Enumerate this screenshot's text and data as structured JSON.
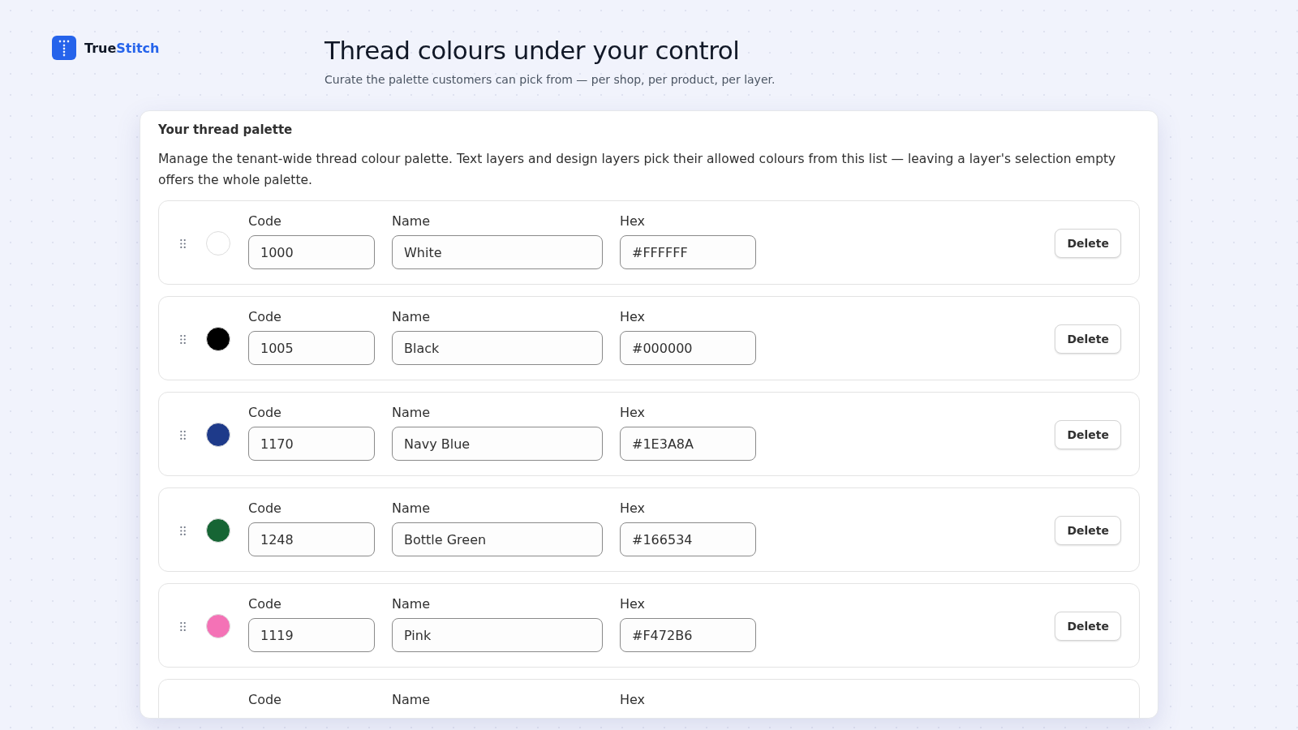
{
  "brand": {
    "name_plain": "True",
    "name_accent": "Stitch"
  },
  "header": {
    "title": "Thread colours under your control",
    "subtitle": "Curate the palette customers can pick from — per shop, per product, per layer."
  },
  "palette": {
    "title": "Your thread palette",
    "description": "Manage the tenant-wide thread colour palette. Text layers and design layers pick their allowed colours from this list — leaving a layer's selection empty offers the whole palette.",
    "rows": [
      {
        "color": "#ffffff",
        "code_label": "Code",
        "code": "1000",
        "name_label": "Name",
        "name": "White",
        "hex_label": "Hex",
        "hex": "#FFFFFF",
        "action": "Delete"
      },
      {
        "color": "#000000",
        "code_label": "Code",
        "code": "1005",
        "name_label": "Name",
        "name": "Black",
        "hex_label": "Hex",
        "hex": "#000000",
        "action": "Delete"
      },
      {
        "color": "#1e3a8a",
        "code_label": "Code",
        "code": "1170",
        "name_label": "Name",
        "name": "Navy Blue",
        "hex_label": "Hex",
        "hex": "#1E3A8A",
        "action": "Delete"
      },
      {
        "color": "#166534",
        "code_label": "Code",
        "code": "1248",
        "name_label": "Name",
        "name": "Bottle Green",
        "hex_label": "Hex",
        "hex": "#166534",
        "action": "Delete"
      },
      {
        "color": "#f472b6",
        "code_label": "Code",
        "code": "1119",
        "name_label": "Name",
        "name": "Pink",
        "hex_label": "Hex",
        "hex": "#F472B6",
        "action": "Delete"
      },
      {
        "code_label": "Code",
        "name_label": "Name",
        "hex_label": "Hex"
      }
    ]
  }
}
